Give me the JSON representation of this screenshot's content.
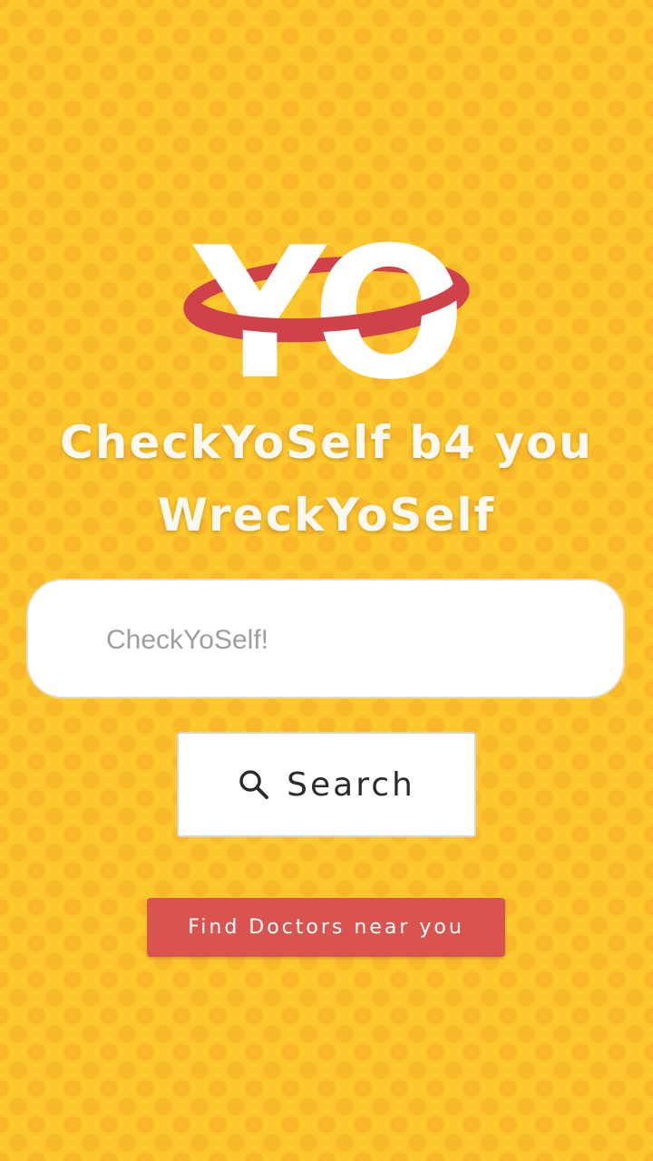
{
  "app": {
    "logo_text": "YO"
  },
  "tagline": {
    "line1": "CheckYoSelf b4 you",
    "line2": "WreckYoSelf"
  },
  "search": {
    "placeholder": "CheckYoSelf!",
    "value": "",
    "button_label": "Search",
    "button_icon": "search-icon"
  },
  "doctors": {
    "button_label": "Find Doctors near you"
  },
  "colors": {
    "background": "#fcc72c",
    "background_dots": "#f9b72a",
    "logo_ring": "#d0424a",
    "tagline_text": "#fbf8ef",
    "doctor_button": "#d9534f"
  }
}
